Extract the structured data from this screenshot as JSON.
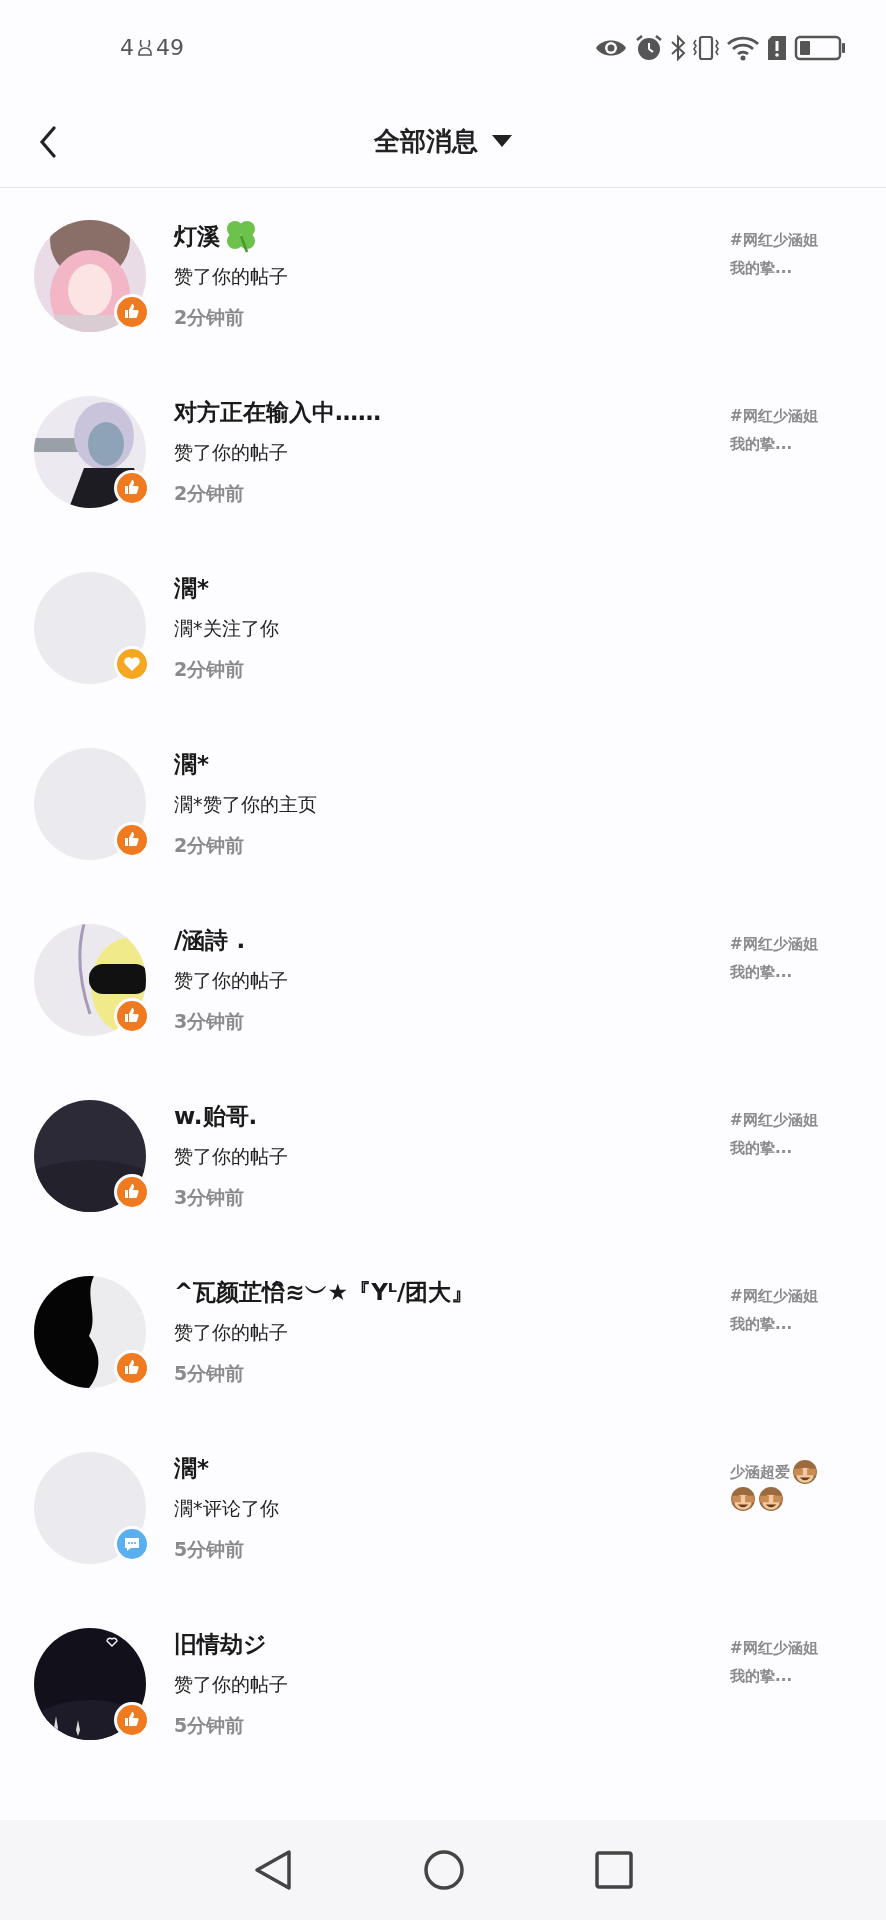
{
  "status_bar": {
    "time_hour": "4",
    "time_minutes": "49"
  },
  "header": {
    "title": "全部消息"
  },
  "messages": [
    {
      "name": "灯溪",
      "name_icon": {
        "kind": "clover"
      },
      "action": "赞了你的帖子",
      "time": "2分钟前",
      "badge": {
        "kind": "like"
      },
      "avatar": {
        "kind": "pink"
      },
      "snippet": "#网红少涵姐我的挚..."
    },
    {
      "name": "对方正在输入中……",
      "action": "赞了你的帖子",
      "time": "2分钟前",
      "badge": {
        "kind": "like"
      },
      "avatar": {
        "kind": "grey"
      },
      "snippet": "#网红少涵姐我的挚..."
    },
    {
      "name": "濶*",
      "action": "濶*关注了你",
      "time": "2分钟前",
      "badge": {
        "kind": "follow"
      },
      "avatar": {
        "kind": "blank"
      }
    },
    {
      "name": "濶*",
      "action": "濶*赞了你的主页",
      "time": "2分钟前",
      "badge": {
        "kind": "like"
      },
      "avatar": {
        "kind": "blank"
      }
    },
    {
      "name": "/涵詩 .",
      "action": "赞了你的帖子",
      "time": "3分钟前",
      "badge": {
        "kind": "like"
      },
      "avatar": {
        "kind": "yellow"
      },
      "snippet": "#网红少涵姐我的挚..."
    },
    {
      "name": "w.贻哥.",
      "action": "赞了你的帖子",
      "time": "3分钟前",
      "badge": {
        "kind": "like"
      },
      "avatar": {
        "kind": "dark"
      },
      "snippet": "#网红少涵姐我的挚..."
    },
    {
      "name": "^瓦颜芷怡ิ≋︶★『Yᴸ/团大』",
      "action": "赞了你的帖子",
      "time": "5分钟前",
      "badge": {
        "kind": "like"
      },
      "avatar": {
        "kind": "silhouette"
      },
      "snippet": "#网红少涵姐我的挚..."
    },
    {
      "name": "濶*",
      "action": "濶*评论了你",
      "time": "5分钟前",
      "badge": {
        "kind": "comment"
      },
      "avatar": {
        "kind": "blank"
      },
      "snippet": "少涵超爱",
      "snippet_icons": [
        {
          "kind": "monkey"
        },
        {
          "kind": "monkey"
        },
        {
          "kind": "monkey"
        }
      ]
    },
    {
      "name": "旧情劫ジ",
      "action": "赞了你的帖子",
      "time": "5分钟前",
      "badge": {
        "kind": "like"
      },
      "avatar": {
        "kind": "night"
      },
      "snippet": "#网红少涵姐我的挚..."
    }
  ]
}
